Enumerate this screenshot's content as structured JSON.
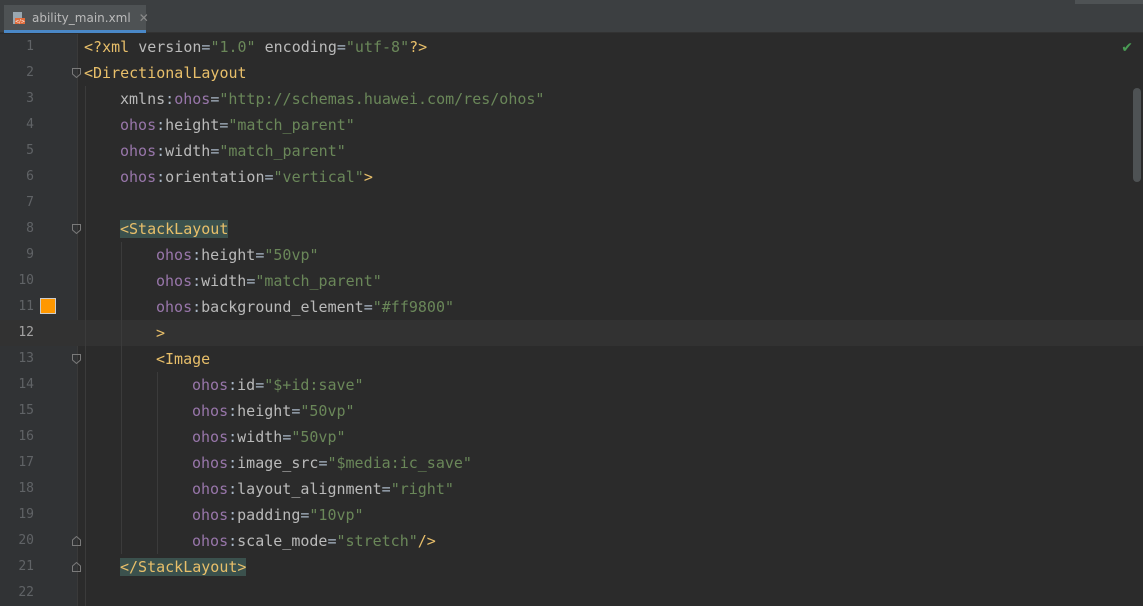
{
  "tab": {
    "filename": "ability_main.xml",
    "close_glyph": "✕",
    "file_icon": "xml-file-icon"
  },
  "status": {
    "inspection_glyph": "✔",
    "inspection_color": "#499c54"
  },
  "current_line": 12,
  "colors": {
    "swatch": "#ff9800",
    "tag": "#e8bf6a",
    "namespace": "#9876aa",
    "string": "#6a8759"
  },
  "lines": [
    {
      "n": "1",
      "tokens": [
        [
          "decl",
          "<?"
        ],
        [
          "tag",
          "xml "
        ],
        [
          "attr",
          "version"
        ],
        [
          "pun",
          "="
        ],
        [
          "str",
          "\"1.0\""
        ],
        [
          "attr",
          " encoding"
        ],
        [
          "pun",
          "="
        ],
        [
          "str",
          "\"utf-8\""
        ],
        [
          "decl",
          "?>"
        ]
      ]
    },
    {
      "n": "2",
      "tokens": [
        [
          "tag",
          "<DirectionalLayout"
        ]
      ]
    },
    {
      "n": "3",
      "tokens": [
        [
          "attr",
          "xmlns"
        ],
        [
          "pun",
          ":"
        ],
        [
          "ns",
          "ohos"
        ],
        [
          "pun",
          "="
        ],
        [
          "str",
          "\"http://schemas.huawei.com/res/ohos\""
        ]
      ]
    },
    {
      "n": "4",
      "tokens": [
        [
          "ns",
          "ohos"
        ],
        [
          "pun",
          ":"
        ],
        [
          "attr",
          "height"
        ],
        [
          "pun",
          "="
        ],
        [
          "str",
          "\"match_parent\""
        ]
      ]
    },
    {
      "n": "5",
      "tokens": [
        [
          "ns",
          "ohos"
        ],
        [
          "pun",
          ":"
        ],
        [
          "attr",
          "width"
        ],
        [
          "pun",
          "="
        ],
        [
          "str",
          "\"match_parent\""
        ]
      ]
    },
    {
      "n": "6",
      "tokens": [
        [
          "ns",
          "ohos"
        ],
        [
          "pun",
          ":"
        ],
        [
          "attr",
          "orientation"
        ],
        [
          "pun",
          "="
        ],
        [
          "str",
          "\"vertical\""
        ],
        [
          "tag",
          ">"
        ]
      ]
    },
    {
      "n": "7",
      "tokens": []
    },
    {
      "n": "8",
      "tokens": [
        [
          "tag",
          "<StackLayout"
        ]
      ]
    },
    {
      "n": "9",
      "tokens": [
        [
          "ns",
          "ohos"
        ],
        [
          "pun",
          ":"
        ],
        [
          "attr",
          "height"
        ],
        [
          "pun",
          "="
        ],
        [
          "str",
          "\"50vp\""
        ]
      ]
    },
    {
      "n": "10",
      "tokens": [
        [
          "ns",
          "ohos"
        ],
        [
          "pun",
          ":"
        ],
        [
          "attr",
          "width"
        ],
        [
          "pun",
          "="
        ],
        [
          "str",
          "\"match_parent\""
        ]
      ]
    },
    {
      "n": "11",
      "tokens": [
        [
          "ns",
          "ohos"
        ],
        [
          "pun",
          ":"
        ],
        [
          "attr",
          "background_element"
        ],
        [
          "pun",
          "="
        ],
        [
          "str",
          "\"#ff9800\""
        ]
      ]
    },
    {
      "n": "12",
      "tokens": [
        [
          "tag",
          ">"
        ]
      ]
    },
    {
      "n": "13",
      "tokens": [
        [
          "tag",
          "<Image"
        ]
      ]
    },
    {
      "n": "14",
      "tokens": [
        [
          "ns",
          "ohos"
        ],
        [
          "pun",
          ":"
        ],
        [
          "attr",
          "id"
        ],
        [
          "pun",
          "="
        ],
        [
          "str",
          "\"$+id:save\""
        ]
      ]
    },
    {
      "n": "15",
      "tokens": [
        [
          "ns",
          "ohos"
        ],
        [
          "pun",
          ":"
        ],
        [
          "attr",
          "height"
        ],
        [
          "pun",
          "="
        ],
        [
          "str",
          "\"50vp\""
        ]
      ]
    },
    {
      "n": "16",
      "tokens": [
        [
          "ns",
          "ohos"
        ],
        [
          "pun",
          ":"
        ],
        [
          "attr",
          "width"
        ],
        [
          "pun",
          "="
        ],
        [
          "str",
          "\"50vp\""
        ]
      ]
    },
    {
      "n": "17",
      "tokens": [
        [
          "ns",
          "ohos"
        ],
        [
          "pun",
          ":"
        ],
        [
          "attr",
          "image_src"
        ],
        [
          "pun",
          "="
        ],
        [
          "str",
          "\"$media:ic_save\""
        ]
      ]
    },
    {
      "n": "18",
      "tokens": [
        [
          "ns",
          "ohos"
        ],
        [
          "pun",
          ":"
        ],
        [
          "attr",
          "layout_alignment"
        ],
        [
          "pun",
          "="
        ],
        [
          "str",
          "\"right\""
        ]
      ]
    },
    {
      "n": "19",
      "tokens": [
        [
          "ns",
          "ohos"
        ],
        [
          "pun",
          ":"
        ],
        [
          "attr",
          "padding"
        ],
        [
          "pun",
          "="
        ],
        [
          "str",
          "\"10vp\""
        ]
      ]
    },
    {
      "n": "20",
      "tokens": [
        [
          "ns",
          "ohos"
        ],
        [
          "pun",
          ":"
        ],
        [
          "attr",
          "scale_mode"
        ],
        [
          "pun",
          "="
        ],
        [
          "str",
          "\"stretch\""
        ],
        [
          "tag",
          "/>"
        ]
      ]
    },
    {
      "n": "21",
      "tokens": [
        [
          "tag",
          "</StackLayout>"
        ]
      ]
    },
    {
      "n": "22",
      "tokens": []
    }
  ]
}
